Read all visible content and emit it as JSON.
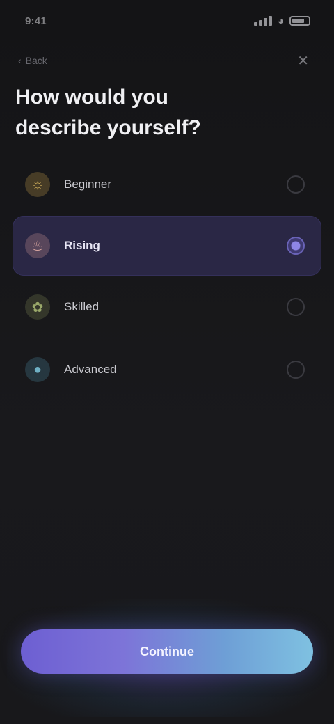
{
  "status_bar": {
    "time": "9:41"
  },
  "top": {
    "back_label": "Back"
  },
  "heading": {
    "line1": "How would you",
    "line2": "describe yourself?"
  },
  "options": [
    {
      "label": "Beginner",
      "icon": "sun-icon",
      "color": "#c9a34a",
      "selected": false
    },
    {
      "label": "Rising",
      "icon": "flame-icon",
      "color": "#c58f8f",
      "selected": true
    },
    {
      "label": "Skilled",
      "icon": "leaf-icon",
      "color": "#7d8a55",
      "selected": false
    },
    {
      "label": "Advanced",
      "icon": "drop-icon",
      "color": "#4a8aa0",
      "selected": false
    }
  ],
  "cta": {
    "label": "Continue"
  },
  "colors": {
    "accent": "#6d5fd2",
    "accent_end": "#7fc1e1",
    "selected_bg": "#2a2745"
  }
}
